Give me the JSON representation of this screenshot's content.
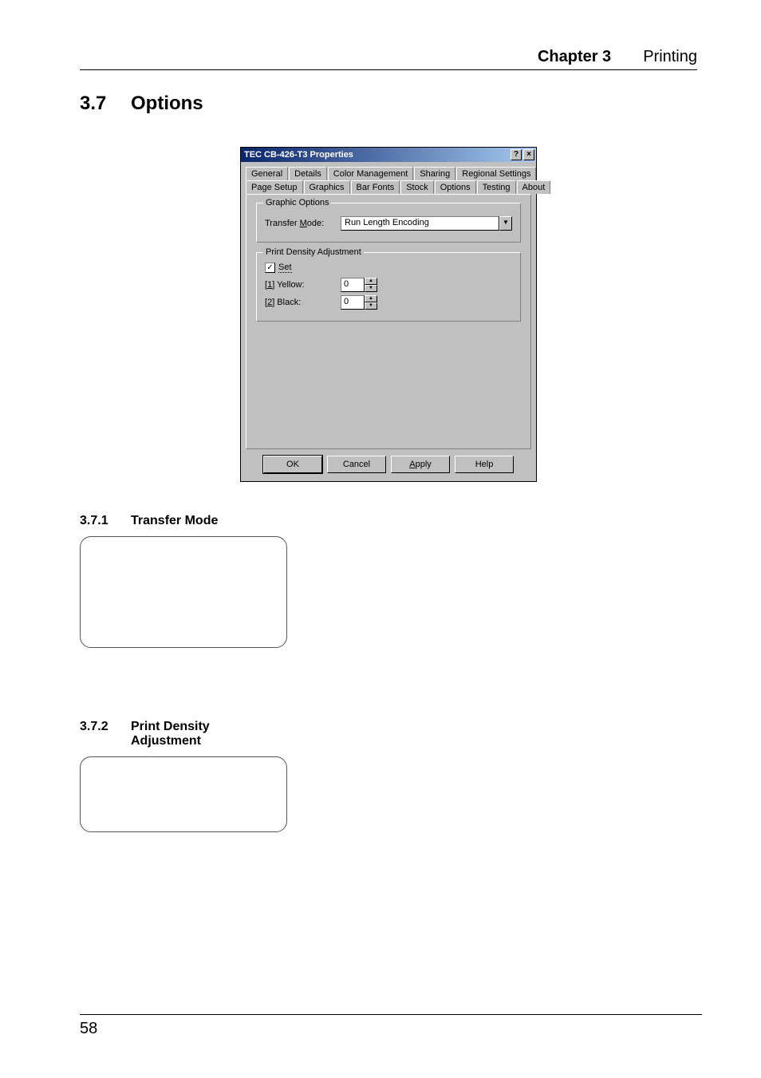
{
  "header": {
    "chapter": "Chapter 3",
    "title": "Printing"
  },
  "section": {
    "number": "3.7",
    "title": "Options"
  },
  "subsections": [
    {
      "number": "3.7.1",
      "title": "Transfer Mode"
    },
    {
      "number": "3.7.2",
      "title": "Print Density Adjustment"
    }
  ],
  "footer": {
    "page_number": "58"
  },
  "dialog": {
    "title": "TEC CB-426-T3 Properties",
    "titlebar_buttons": {
      "help": "?",
      "close": "×"
    },
    "tabs_row1": [
      "General",
      "Details",
      "Color Management",
      "Sharing",
      "Regional Settings"
    ],
    "tabs_row2": [
      "Page Setup",
      "Graphics",
      "Bar Fonts",
      "Stock",
      "Options",
      "Testing",
      "About"
    ],
    "active_tab": "Options",
    "group_graphic": {
      "legend": "Graphic Options",
      "transfer_mode_label": "Transfer Mode:",
      "transfer_mode_underline": "M",
      "transfer_mode_value": "Run Length Encoding"
    },
    "group_density": {
      "legend": "Print Density Adjustment",
      "set_checkbox": {
        "label": "Set",
        "checked": true,
        "underline": "S"
      },
      "rows": [
        {
          "prefix": "[1]",
          "label": " Yellow:",
          "underline": "1",
          "value": "0"
        },
        {
          "prefix": "[2]",
          "label": " Black:",
          "underline": "2",
          "value": "0"
        }
      ]
    },
    "buttons": {
      "ok": "OK",
      "cancel": "Cancel",
      "apply": "Apply",
      "apply_underline": "A",
      "help": "Help"
    },
    "combo_arrow": "▼",
    "spin_up": "▲",
    "spin_down": "▼",
    "check_mark": "✓"
  }
}
